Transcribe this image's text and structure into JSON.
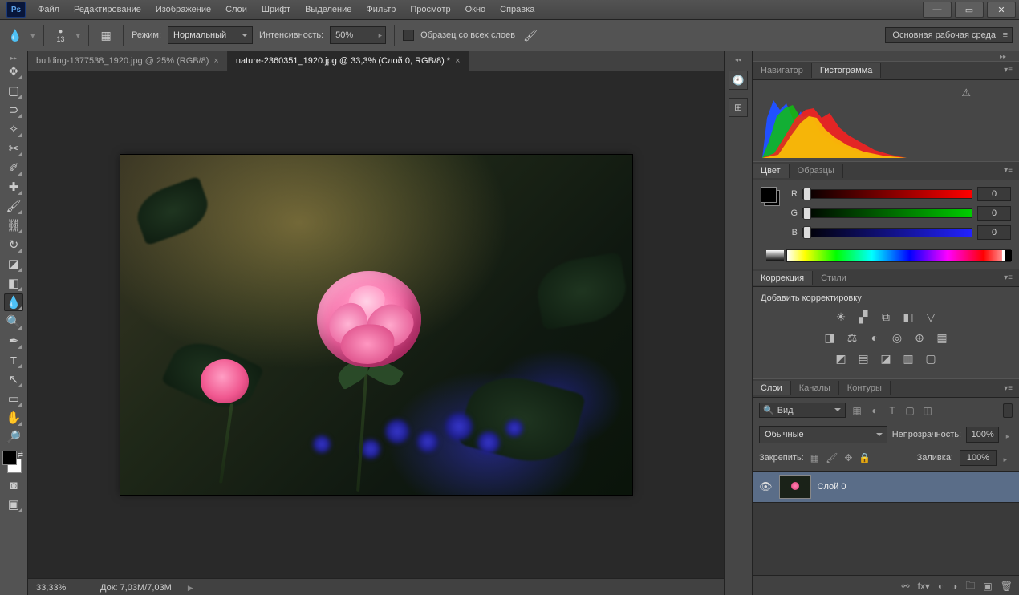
{
  "app": "Ps",
  "menu": [
    "Файл",
    "Редактирование",
    "Изображение",
    "Слои",
    "Шрифт",
    "Выделение",
    "Фильтр",
    "Просмотр",
    "Окно",
    "Справка"
  ],
  "optbar": {
    "brush_size": "13",
    "mode_label": "Режим:",
    "mode_value": "Нормальный",
    "strength_label": "Интенсивность:",
    "strength_value": "50%",
    "sample_all": "Образец со всех слоев",
    "workspace": "Основная рабочая среда"
  },
  "tabs": [
    {
      "title": "building-1377538_1920.jpg @ 25% (RGB/8)",
      "active": false
    },
    {
      "title": "nature-2360351_1920.jpg @ 33,3% (Слой 0, RGB/8) *",
      "active": true
    }
  ],
  "status": {
    "zoom": "33,33%",
    "doc_label": "Док:",
    "doc_value": "7,03M/7,03M"
  },
  "panels": {
    "nav_tabs": [
      "Навигатор",
      "Гистограмма"
    ],
    "color_tabs": [
      "Цвет",
      "Образцы"
    ],
    "corr_tabs": [
      "Коррекция",
      "Стили"
    ],
    "corr_title": "Добавить корректировку",
    "layer_tabs": [
      "Слои",
      "Каналы",
      "Контуры"
    ],
    "rgb": {
      "r": "0",
      "g": "0",
      "b": "0"
    },
    "search": "Вид",
    "blend": "Обычные",
    "opacity_label": "Непрозрачность:",
    "opacity": "100%",
    "lock_label": "Закрепить:",
    "fill_label": "Заливка:",
    "fill": "100%",
    "layer0": "Слой 0"
  }
}
